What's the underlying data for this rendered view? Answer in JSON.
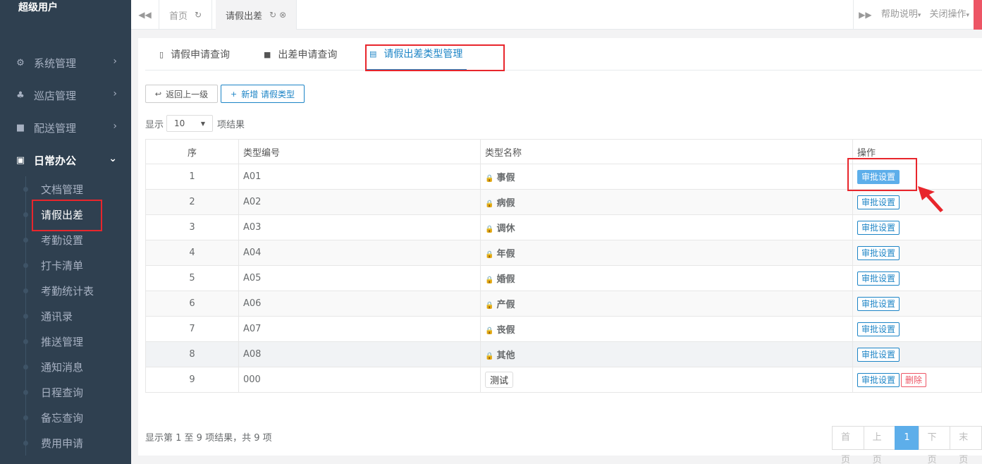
{
  "user": {
    "name": "超级用户"
  },
  "sidebar": {
    "menus": [
      {
        "label": "系统管理",
        "icon": "cogs-icon",
        "glyph": "⚙"
      },
      {
        "label": "巡店管理",
        "icon": "sitemap-icon",
        "glyph": "♣"
      },
      {
        "label": "配送管理",
        "icon": "truck-icon",
        "glyph": "■"
      },
      {
        "label": "日常办公",
        "icon": "briefcase-icon",
        "glyph": "▣"
      }
    ],
    "chevron_right": "›",
    "chevron_down": "⌄",
    "submenu": [
      "文档管理",
      "请假出差",
      "考勤设置",
      "打卡清单",
      "考勤统计表",
      "通讯录",
      "推送管理",
      "通知消息",
      "日程查询",
      "备忘查询",
      "费用申请"
    ]
  },
  "topbar": {
    "back_glyph": "◀◀",
    "tabs": [
      {
        "label": "首页",
        "refresh": "↻"
      },
      {
        "label": "请假出差",
        "refresh": "↻",
        "close": "⊗"
      }
    ],
    "forward_glyph": "▶▶",
    "help_label": "帮助说明",
    "close_ops_label": "关闭操作",
    "caret": "▾"
  },
  "subtabs": [
    {
      "label": "请假申请查询",
      "glyph": "▯"
    },
    {
      "label": "出差申请查询",
      "glyph": "■"
    },
    {
      "label": "请假出差类型管理",
      "glyph": "▤"
    }
  ],
  "toolbar": {
    "back_label": "返回上一级",
    "back_glyph": "↩",
    "add_label": "新增 请假类型",
    "add_glyph": "+"
  },
  "length": {
    "prefix": "显示",
    "value": "10",
    "suffix": "项结果",
    "caret": "▼"
  },
  "table": {
    "headers": [
      "序",
      "类型编号",
      "类型名称",
      "操作"
    ],
    "lock_glyph": "🔒",
    "approve_label": "审批设置",
    "delete_label": "删除",
    "rows": [
      {
        "idx": "1",
        "code": "A01",
        "name": "事假"
      },
      {
        "idx": "2",
        "code": "A02",
        "name": "病假"
      },
      {
        "idx": "3",
        "code": "A03",
        "name": "调休"
      },
      {
        "idx": "4",
        "code": "A04",
        "name": "年假"
      },
      {
        "idx": "5",
        "code": "A05",
        "name": "婚假"
      },
      {
        "idx": "6",
        "code": "A06",
        "name": "产假"
      },
      {
        "idx": "7",
        "code": "A07",
        "name": "丧假"
      },
      {
        "idx": "8",
        "code": "A08",
        "name": "其他"
      },
      {
        "idx": "9",
        "code": "000",
        "name": "测试"
      }
    ]
  },
  "footer": {
    "info": "显示第 1 至 9 项结果，共 9 项",
    "pager": [
      "首页",
      "上页",
      "1",
      "下页",
      "末页"
    ]
  },
  "colors": {
    "sidebar_bg": "#2f4050",
    "accent": "#1c84c6",
    "highlight": "#e8262c",
    "danger": "#ed5565"
  }
}
